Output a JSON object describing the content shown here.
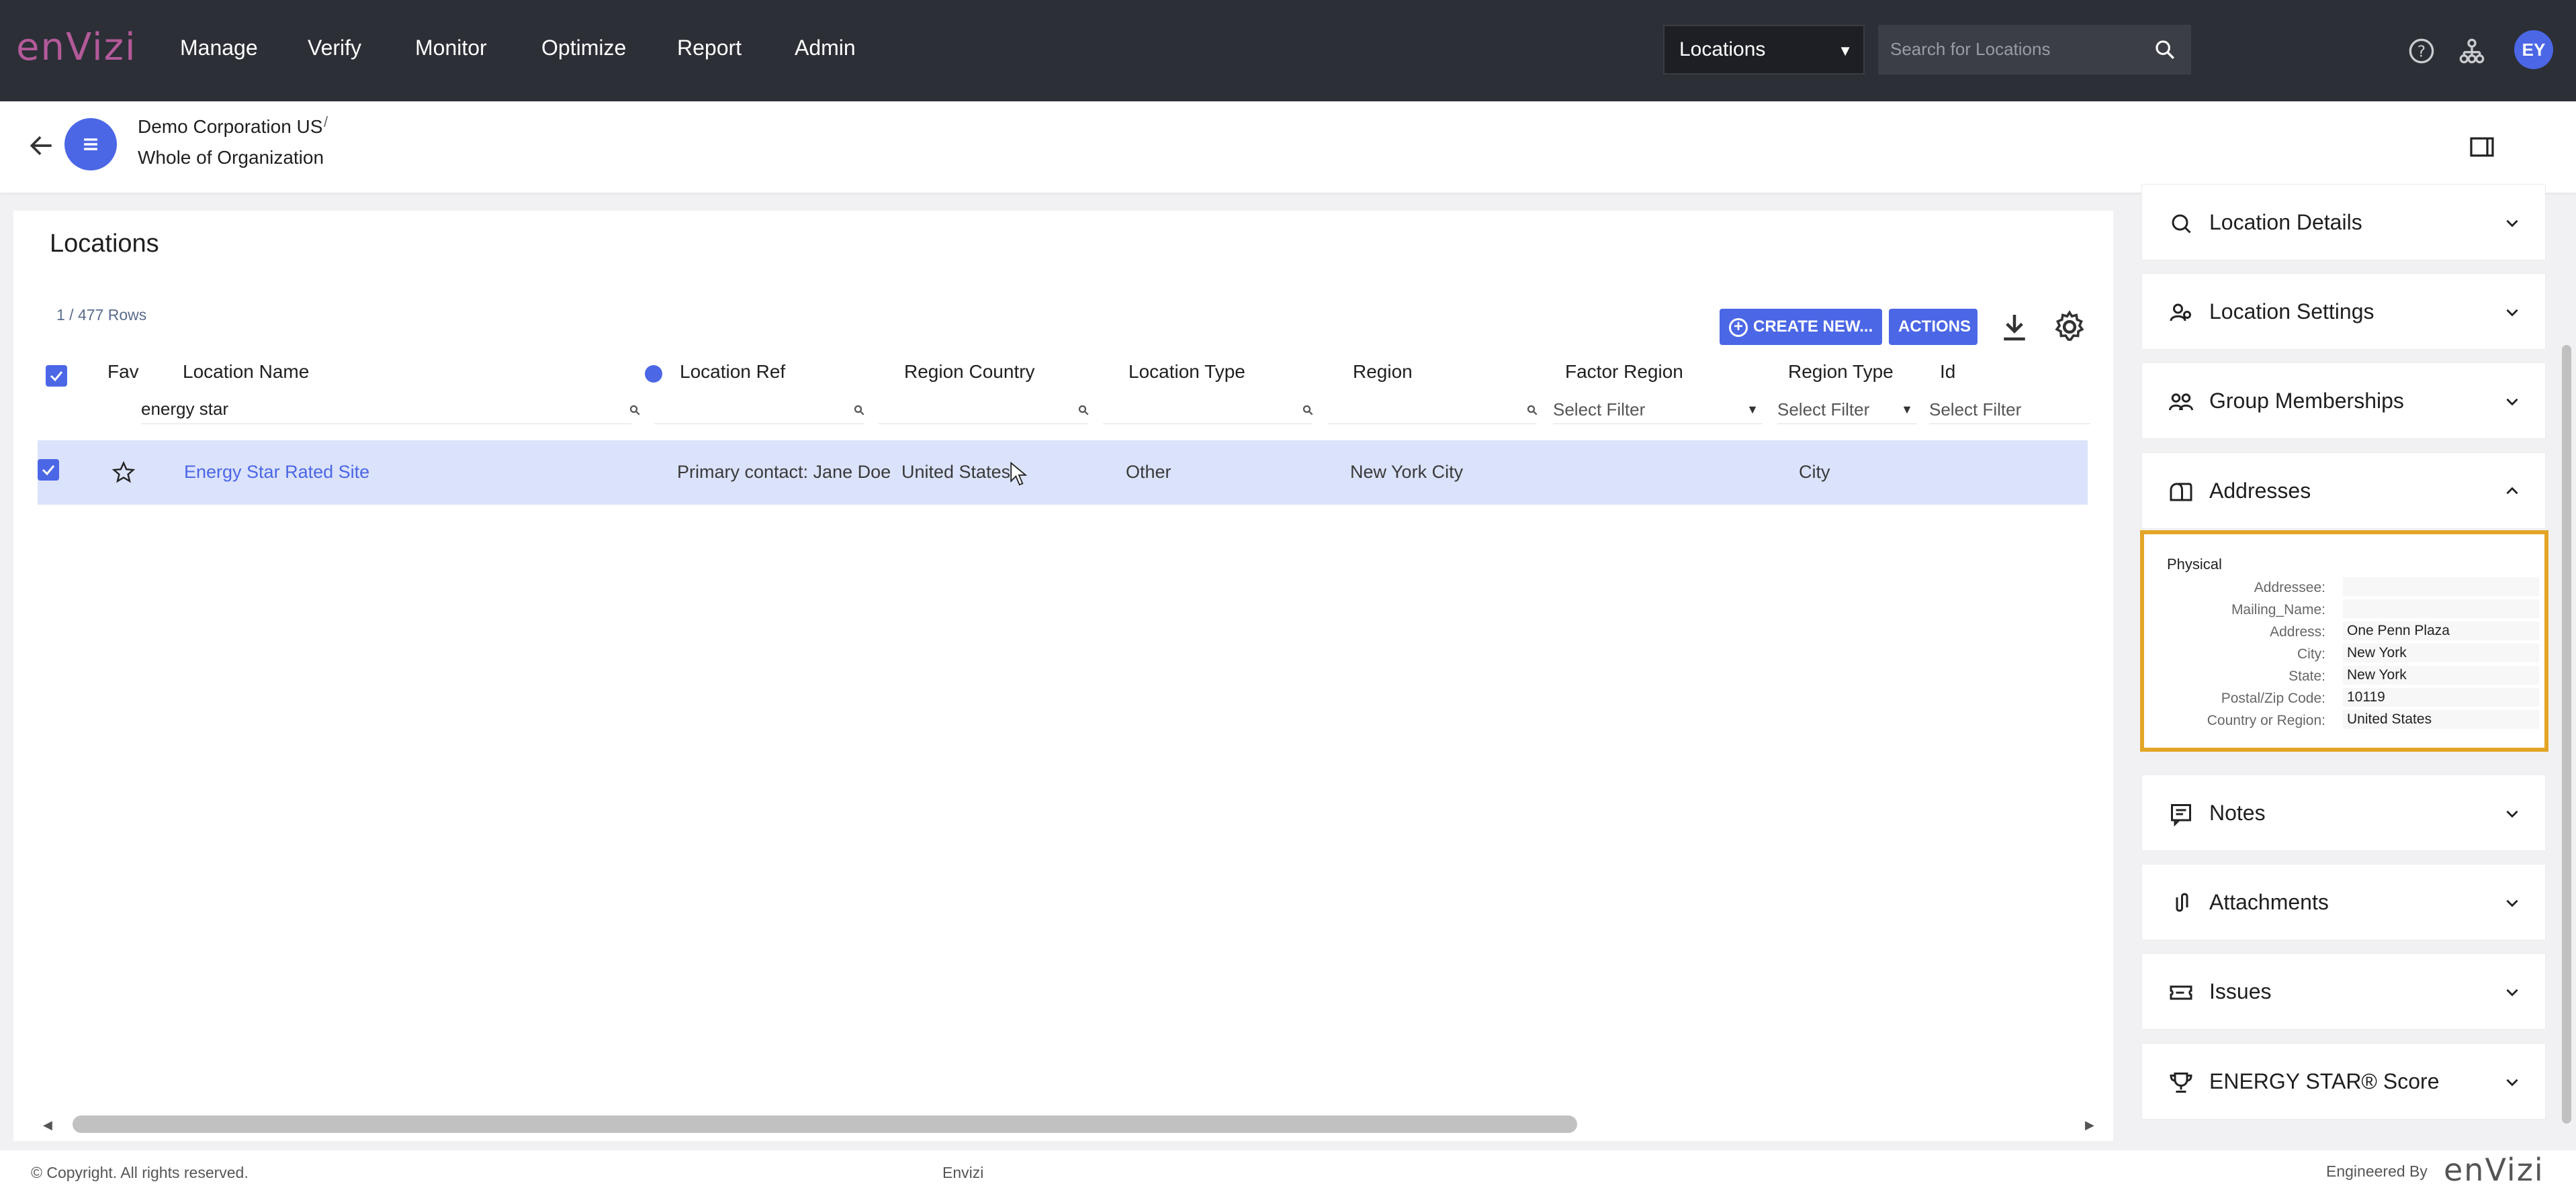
{
  "app": {
    "logo": "enVizi",
    "nav": [
      "Manage",
      "Verify",
      "Monitor",
      "Optimize",
      "Report",
      "Admin"
    ],
    "search_scope": "Locations",
    "search_placeholder": "Search for Locations",
    "avatar_initials": "EY",
    "accent_color": "#4b67e6"
  },
  "breadcrumb": {
    "org": "Demo Corporation US",
    "separator": "/",
    "scope": "Whole of Organization"
  },
  "locations": {
    "title": "Locations",
    "rows_count": "1 / 477 Rows",
    "create_label": "CREATE NEW...",
    "actions_label": "ACTIONS",
    "columns": [
      "Fav",
      "Location Name",
      "Location Ref",
      "Region Country",
      "Location Type",
      "Region",
      "Factor Region",
      "Region Type",
      "Id"
    ],
    "filters": {
      "location_name": "energy star",
      "factor_region": "Select Filter",
      "region_type": "Select Filter",
      "id": "Select Filter"
    },
    "row": {
      "name": "Energy Star Rated Site",
      "ref": "Primary contact: Jane Doe",
      "country": "United States",
      "type": "Other",
      "region": "New York City",
      "factor_region": "",
      "region_type": "City",
      "id": ""
    }
  },
  "panel": {
    "sections": [
      "Location Details",
      "Location Settings",
      "Group Memberships",
      "Addresses",
      "Notes",
      "Attachments",
      "Issues",
      "ENERGY STAR® Score"
    ],
    "address": {
      "heading": "Physical",
      "fields": [
        {
          "label": "Addressee:",
          "value": ""
        },
        {
          "label": "Mailing_Name:",
          "value": ""
        },
        {
          "label": "Address:",
          "value": "One Penn Plaza"
        },
        {
          "label": "City:",
          "value": "New York"
        },
        {
          "label": "State:",
          "value": "New York"
        },
        {
          "label": "Postal/Zip Code:",
          "value": "10119"
        },
        {
          "label": "Country or Region:",
          "value": "United States"
        }
      ]
    }
  },
  "footer": {
    "copyright": "© Copyright. All rights reserved.",
    "center": "Envizi",
    "engineered_by": "Engineered By",
    "logo": "enVizi"
  }
}
